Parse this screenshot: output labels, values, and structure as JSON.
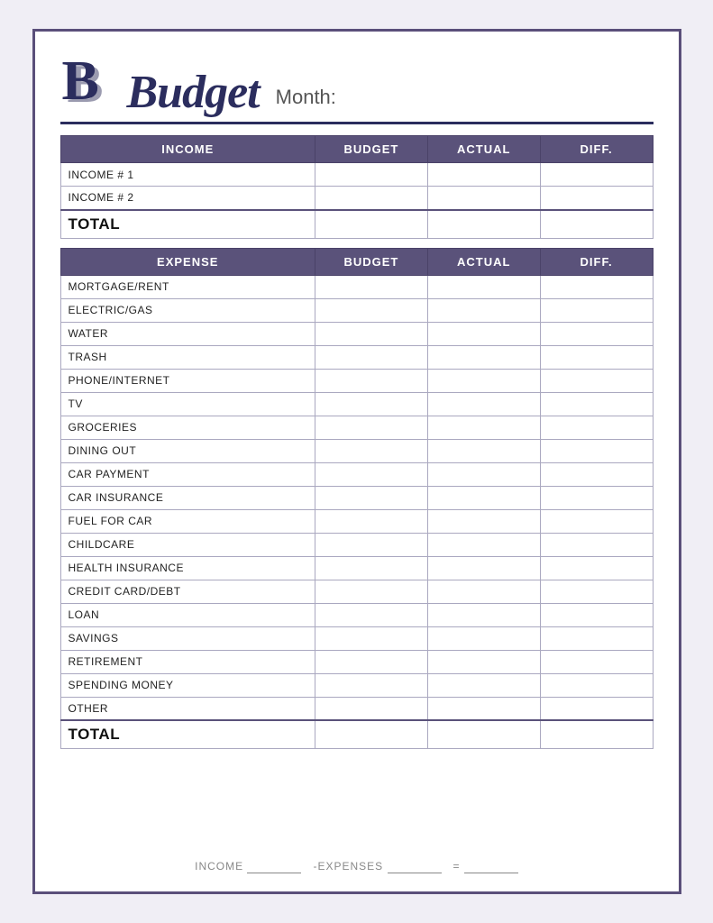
{
  "header": {
    "title": "Budget",
    "month_label": "Month:"
  },
  "income_table": {
    "columns": [
      "INCOME",
      "BUDGET",
      "ACTUAL",
      "DIFF."
    ],
    "rows": [
      {
        "label": "INCOME # 1"
      },
      {
        "label": "INCOME # 2"
      }
    ],
    "total_label": "TOTAL"
  },
  "expense_table": {
    "columns": [
      "EXPENSE",
      "BUDGET",
      "ACTUAL",
      "DIFF."
    ],
    "rows": [
      {
        "label": "MORTGAGE/RENT"
      },
      {
        "label": "ELECTRIC/GAS"
      },
      {
        "label": "WATER"
      },
      {
        "label": "TRASH"
      },
      {
        "label": "PHONE/INTERNET"
      },
      {
        "label": "TV"
      },
      {
        "label": "GROCERIES"
      },
      {
        "label": "DINING OUT"
      },
      {
        "label": "CAR PAYMENT"
      },
      {
        "label": "CAR INSURANCE"
      },
      {
        "label": "FUEL FOR CAR"
      },
      {
        "label": "CHILDCARE"
      },
      {
        "label": "HEALTH INSURANCE"
      },
      {
        "label": "CREDIT CARD/DEBT"
      },
      {
        "label": "LOAN"
      },
      {
        "label": "SAVINGS"
      },
      {
        "label": "RETIREMENT"
      },
      {
        "label": "SPENDING MONEY"
      },
      {
        "label": "OTHER"
      }
    ],
    "total_label": "TOTAL"
  },
  "footer": {
    "income_label": "INCOME",
    "expenses_label": "-EXPENSES",
    "equals": "="
  }
}
